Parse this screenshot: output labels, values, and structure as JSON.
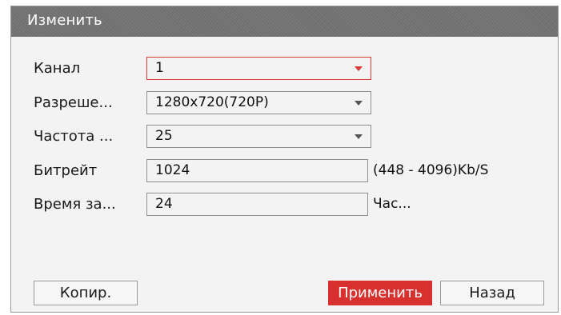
{
  "dialog": {
    "title": "Изменить"
  },
  "rows": [
    {
      "label": "Канал",
      "value": "1",
      "type": "select",
      "active": true
    },
    {
      "label": "Разреше...",
      "value": "1280x720(720P)",
      "type": "select"
    },
    {
      "label": "Частота ...",
      "value": "25",
      "type": "select"
    },
    {
      "label": "Битрейт",
      "value": "1024",
      "type": "input",
      "suffix": "(448 - 4096)Kb/S"
    },
    {
      "label": "Время за...",
      "value": "24",
      "type": "input",
      "suffix": "Час..."
    }
  ],
  "buttons": {
    "copy": "Копир.",
    "apply": "Применить",
    "back": "Назад"
  },
  "colors": {
    "accent": "#d8302e",
    "titlebar": "#757575"
  }
}
